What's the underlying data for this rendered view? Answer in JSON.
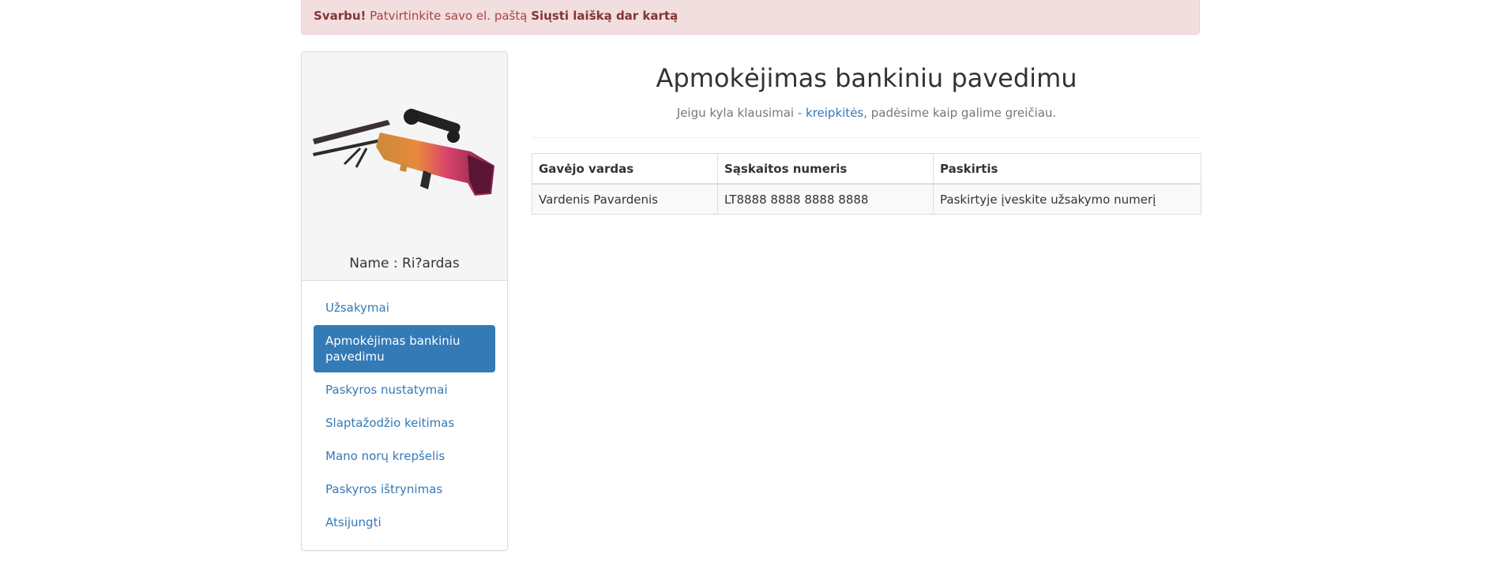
{
  "alert": {
    "important": "Svarbu!",
    "message": " Patvirtinkite savo el. paštą ",
    "resend_link": "Siųsti laišką dar kartą",
    "bg_color": "#f2dede",
    "text_color": "#a94442"
  },
  "sidebar": {
    "profile_name": "Name : Ri?ardas",
    "avatar_icon": "awp-rifle-image",
    "items": [
      {
        "label": "Užsakymai",
        "active": false
      },
      {
        "label": "Apmokėjimas bankiniu pavedimu",
        "active": true
      },
      {
        "label": "Paskyros nustatymai",
        "active": false
      },
      {
        "label": "Slaptažodžio keitimas",
        "active": false
      },
      {
        "label": "Mano norų krepšelis",
        "active": false
      },
      {
        "label": "Paskyros ištrynimas",
        "active": false
      },
      {
        "label": "Atsijungti",
        "active": false
      }
    ],
    "accent_color": "#337ab7"
  },
  "main": {
    "title": "Apmokėjimas bankiniu pavedimu",
    "subtitle_before": "Jeigu kyla klausimai - ",
    "subtitle_link": "kreipkitės",
    "subtitle_after": ", padėsime kaip galime greičiau.",
    "table": {
      "headers": [
        "Gavėjo vardas",
        "Sąskaitos numeris",
        "Paskirtis"
      ],
      "rows": [
        [
          "Vardenis Pavardenis",
          "LT8888 8888 8888 8888",
          "Paskirtyje įveskite užsakymo numerį"
        ]
      ]
    }
  }
}
